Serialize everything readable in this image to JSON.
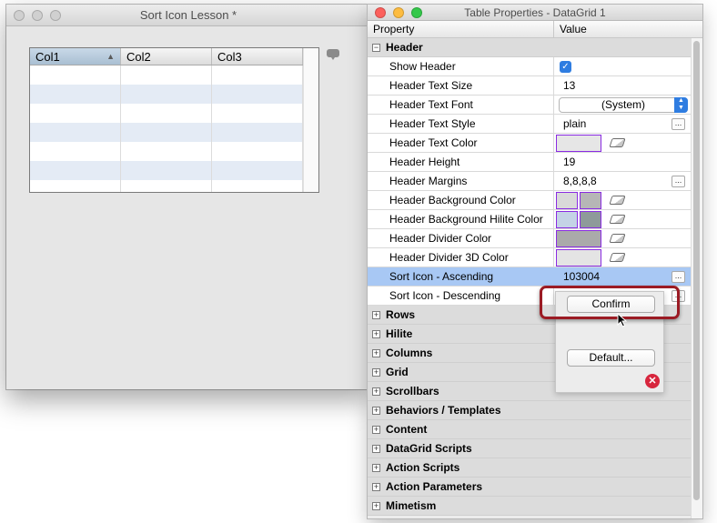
{
  "left_window": {
    "title": "Sort Icon Lesson *",
    "grid": {
      "columns": [
        "Col1",
        "Col2",
        "Col3"
      ],
      "sorted_column": "Col1",
      "sort_arrow": "▲",
      "row_count": 7
    },
    "pin_icon": "speech-pin-icon"
  },
  "inspector": {
    "title": "Table Properties - DataGrid 1",
    "col_property": "Property",
    "col_value": "Value",
    "header_section": "Header",
    "rows": {
      "show_header": {
        "label": "Show Header",
        "checked": true,
        "check": "✓"
      },
      "text_size": {
        "label": "Header Text Size",
        "value": "13"
      },
      "text_font": {
        "label": "Header Text Font",
        "value": "(System)"
      },
      "text_style": {
        "label": "Header Text Style",
        "value": "plain"
      },
      "text_color": {
        "label": "Header Text Color"
      },
      "height": {
        "label": "Header Height",
        "value": "19"
      },
      "margins": {
        "label": "Header Margins",
        "value": "8,8,8,8"
      },
      "bg_color": {
        "label": "Header Background Color"
      },
      "bg_hilite": {
        "label": "Header Background Hilite Color"
      },
      "divider_color": {
        "label": "Header Divider Color"
      },
      "divider_3d": {
        "label": "Header Divider 3D Color"
      },
      "sort_asc": {
        "label": "Sort Icon - Ascending",
        "value": "103004"
      },
      "sort_desc": {
        "label": "Sort Icon - Descending"
      }
    },
    "ellipsis": "...",
    "sections": [
      "Rows",
      "Hilite",
      "Columns",
      "Grid",
      "Scrollbars",
      "Behaviors / Templates",
      "Content",
      "DataGrid Scripts",
      "Action Scripts",
      "Action Parameters",
      "Mimetism"
    ],
    "expand_symbol": "+",
    "collapse_symbol": "−"
  },
  "popup_menu": {
    "confirm": "Confirm",
    "default": "Default...",
    "clear_glyph": "✕"
  },
  "colors": {
    "selection": "#a8c8f4",
    "swatch_border": "#8a2be2",
    "highlight": "#9b1b24",
    "checkbox": "#2f7de1"
  }
}
